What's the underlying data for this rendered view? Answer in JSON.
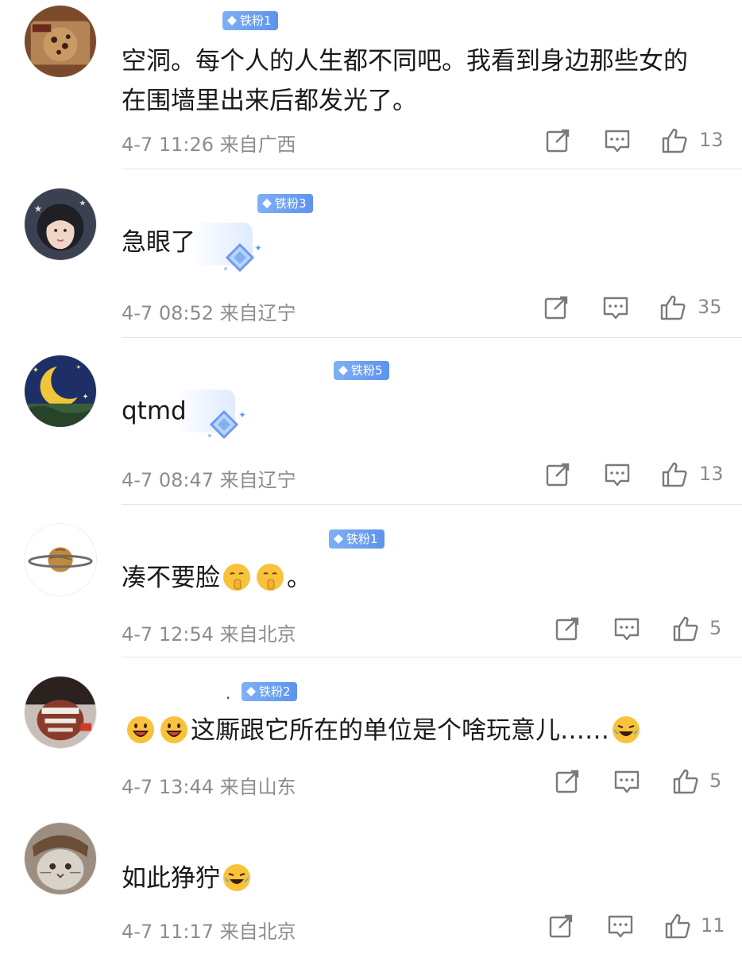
{
  "comments": [
    {
      "badge": "铁粉1",
      "lines": [
        "空洞。每个人的人生都不同吧。我看到身边那些女的",
        "在围墙里出来后都发光了。"
      ],
      "time": "4-7 11:26",
      "location": "来自广西",
      "likes": "13"
    },
    {
      "badge": "铁粉3",
      "lines": [
        "急眼了"
      ],
      "time": "4-7 08:52",
      "location": "来自辽宁",
      "likes": "35"
    },
    {
      "badge": "铁粉5",
      "lines": [
        "qtmd"
      ],
      "time": "4-7 08:47",
      "location": "来自辽宁",
      "likes": "13"
    },
    {
      "badge": "铁粉1",
      "lines": [
        "凑不要脸"
      ],
      "suffix": "。",
      "time": "4-7 12:54",
      "location": "来自北京",
      "likes": "5"
    },
    {
      "badge": "铁粉2",
      "lines": [
        "这厮跟它所在的单位是个啥玩意儿……"
      ],
      "time": "4-7 13:44",
      "location": "来自山东",
      "likes": "5"
    },
    {
      "badge": "",
      "lines": [
        "如此狰狞"
      ],
      "time": "4-7 11:17",
      "location": "来自北京",
      "likes": "11"
    }
  ],
  "icons": {
    "repost": "share-edit-icon",
    "reply": "comment-bubble-icon",
    "like": "thumbs-up-icon"
  },
  "colors": {
    "badge": "#5d93ee",
    "meta": "#8c8c8c",
    "text": "#1a1a1a"
  }
}
